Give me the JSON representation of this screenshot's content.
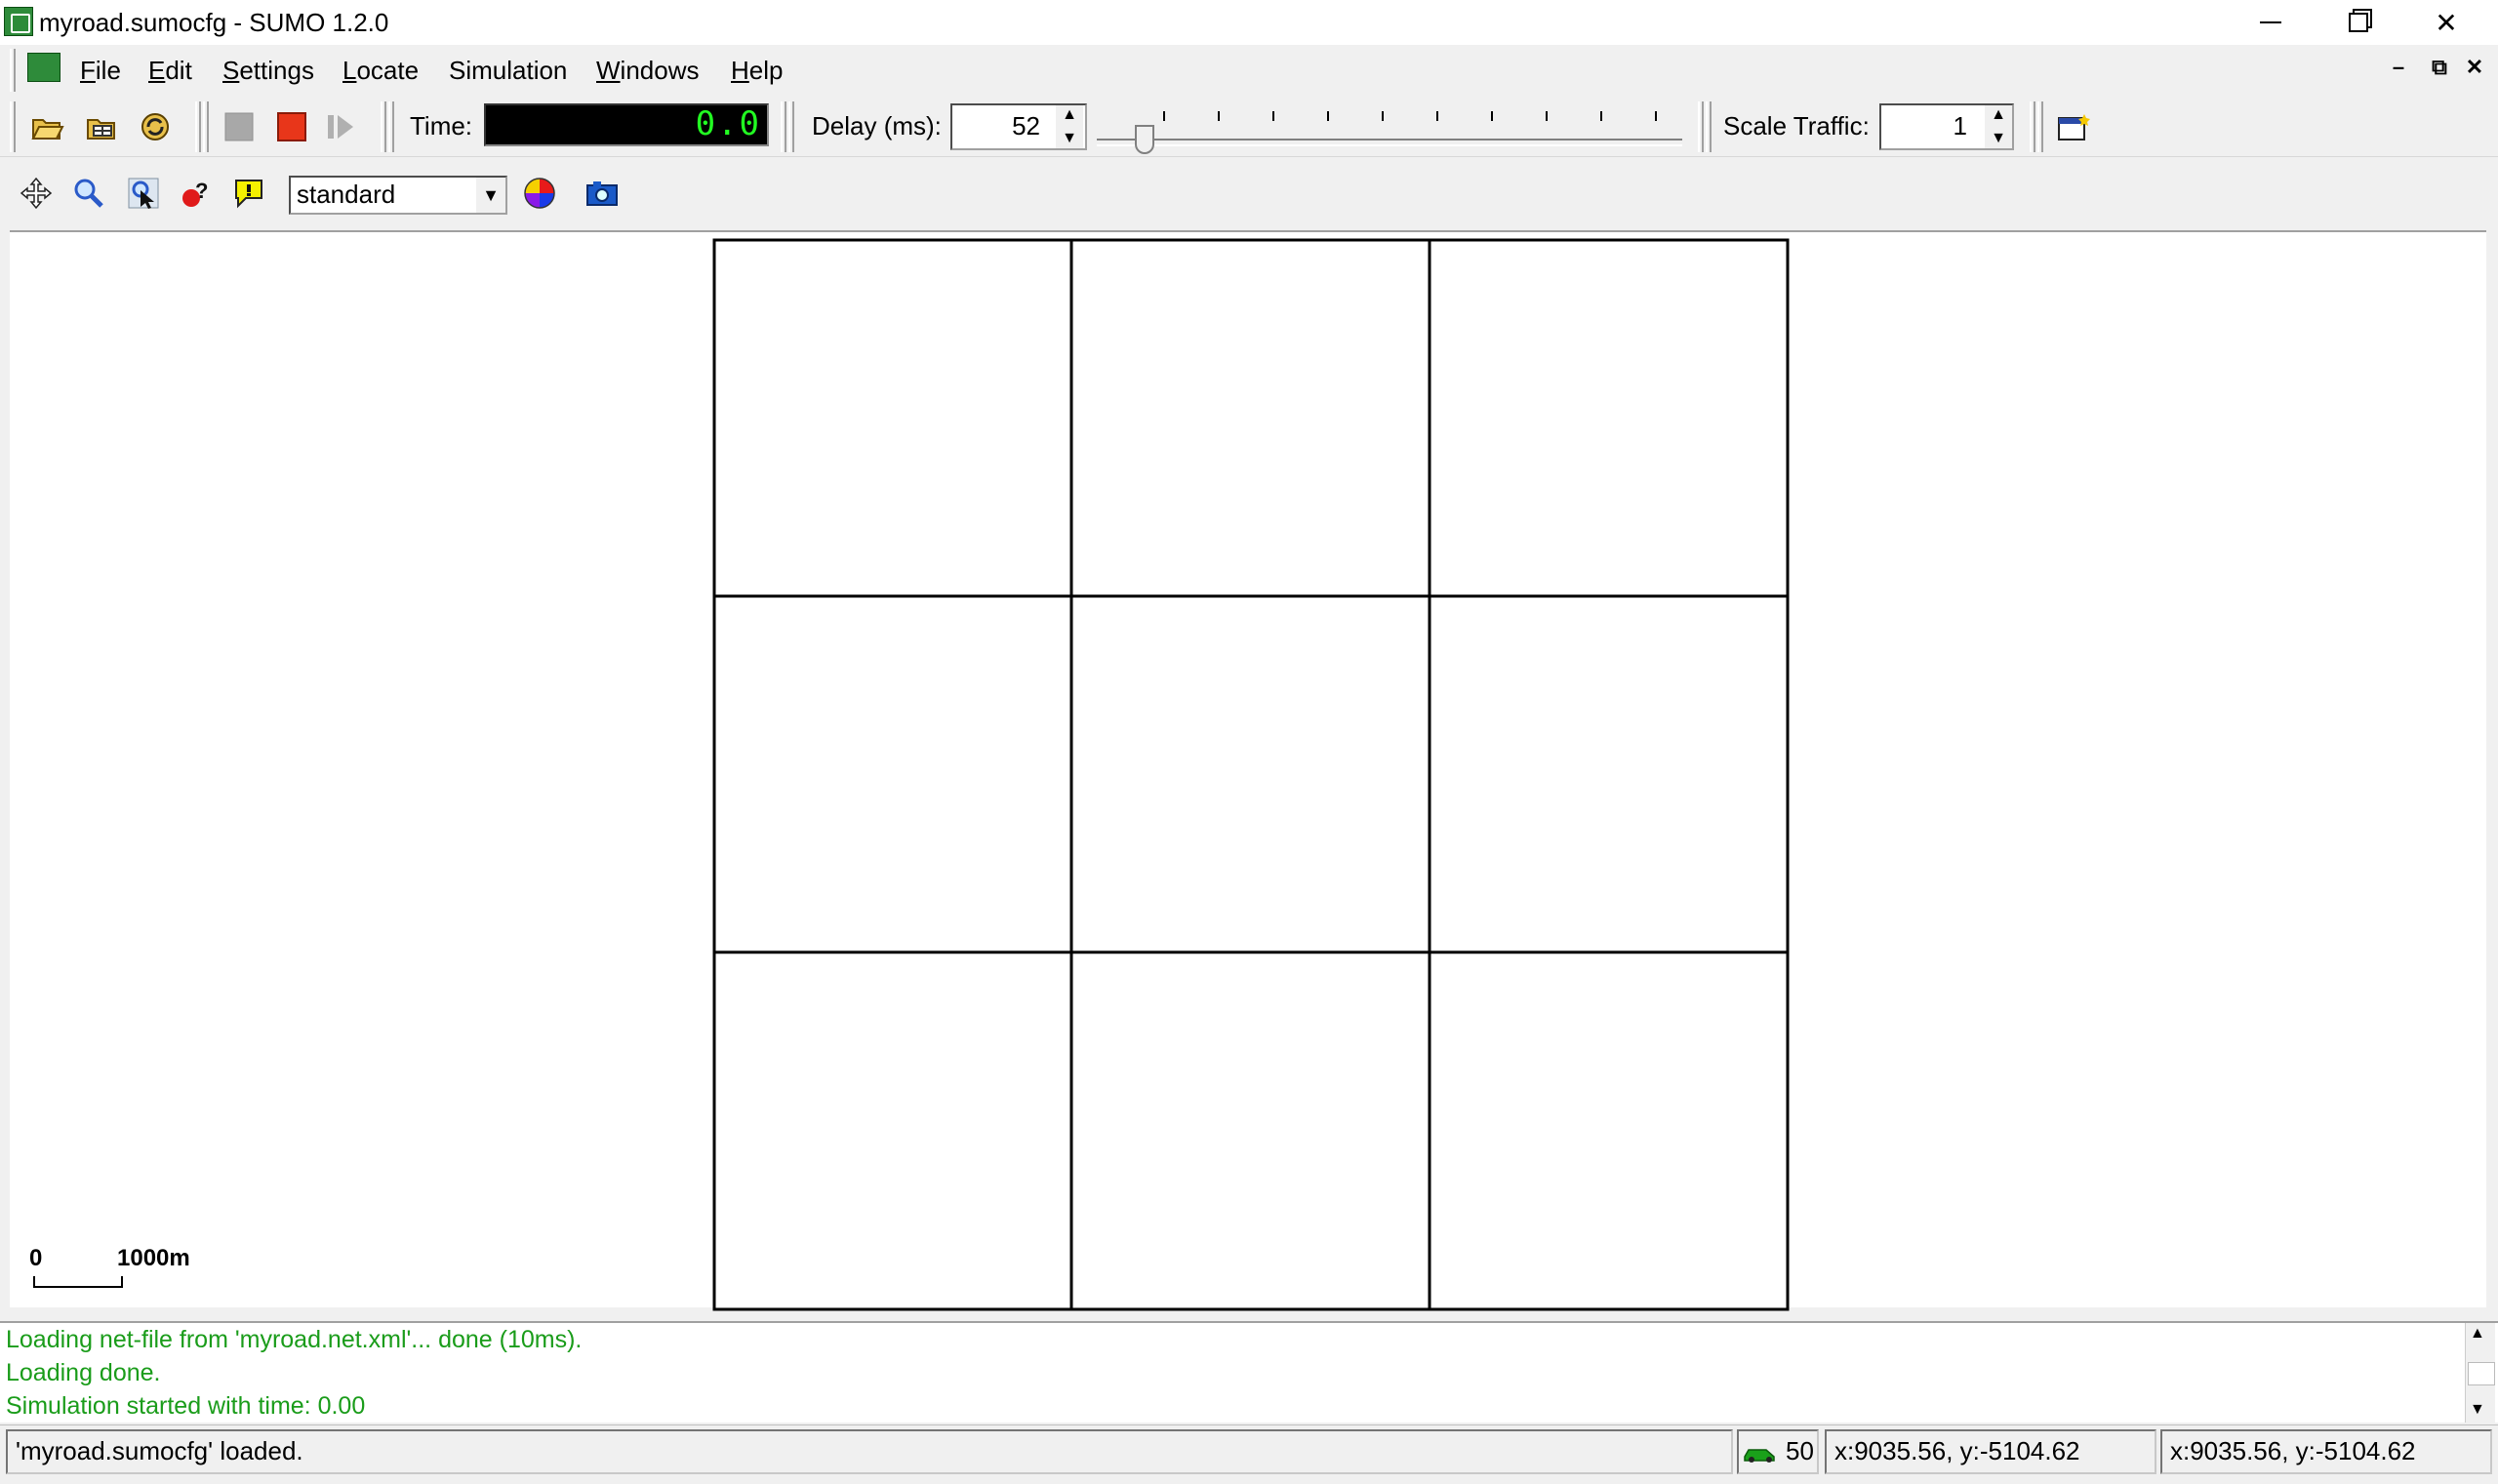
{
  "window": {
    "title": "myroad.sumocfg - SUMO 1.2.0"
  },
  "menu": {
    "items": [
      {
        "label": "File",
        "mnemonic": "F"
      },
      {
        "label": "Edit",
        "mnemonic": "E"
      },
      {
        "label": "Settings",
        "mnemonic": "S"
      },
      {
        "label": "Locate",
        "mnemonic": "L"
      },
      {
        "label": "Simulation",
        "mnemonic": "S"
      },
      {
        "label": "Windows",
        "mnemonic": "W"
      },
      {
        "label": "Help",
        "mnemonic": "H"
      }
    ]
  },
  "toolbar": {
    "buttons": [
      "open-simulation-icon",
      "open-network-icon",
      "reload-icon",
      "run-icon",
      "stop-icon",
      "step-icon"
    ],
    "time_label": "Time:",
    "time_value": "0.0",
    "delay_label": "Delay (ms):",
    "delay_value": "52",
    "delay_slider_fraction": 0.052,
    "scale_label": "Scale Traffic:",
    "scale_value": "1",
    "new_view_icon": "new-view-icon"
  },
  "view_toolbar": {
    "buttons": [
      "recenter-icon",
      "zoom-icon",
      "locate-icon",
      "query-icon",
      "tooltip-icon"
    ],
    "scheme": "standard",
    "color_icon": "color-wheel-icon",
    "snapshot_icon": "camera-icon"
  },
  "scale_bar": {
    "start_label": "0",
    "end_label": "1000m"
  },
  "messages": [
    "Loading net-file from 'myroad.net.xml'... done (10ms).",
    "Loading done.",
    "Simulation started with time: 0.00"
  ],
  "status": {
    "message": "'myroad.sumocfg' loaded.",
    "vehicle_count": "50",
    "coords_1": "x:9035.56, y:-5104.62",
    "coords_2": "x:9035.56, y:-5104.62"
  },
  "colors": {
    "message_text": "#1a9c1a",
    "time_display": "#22ff22",
    "road": "#000000"
  }
}
